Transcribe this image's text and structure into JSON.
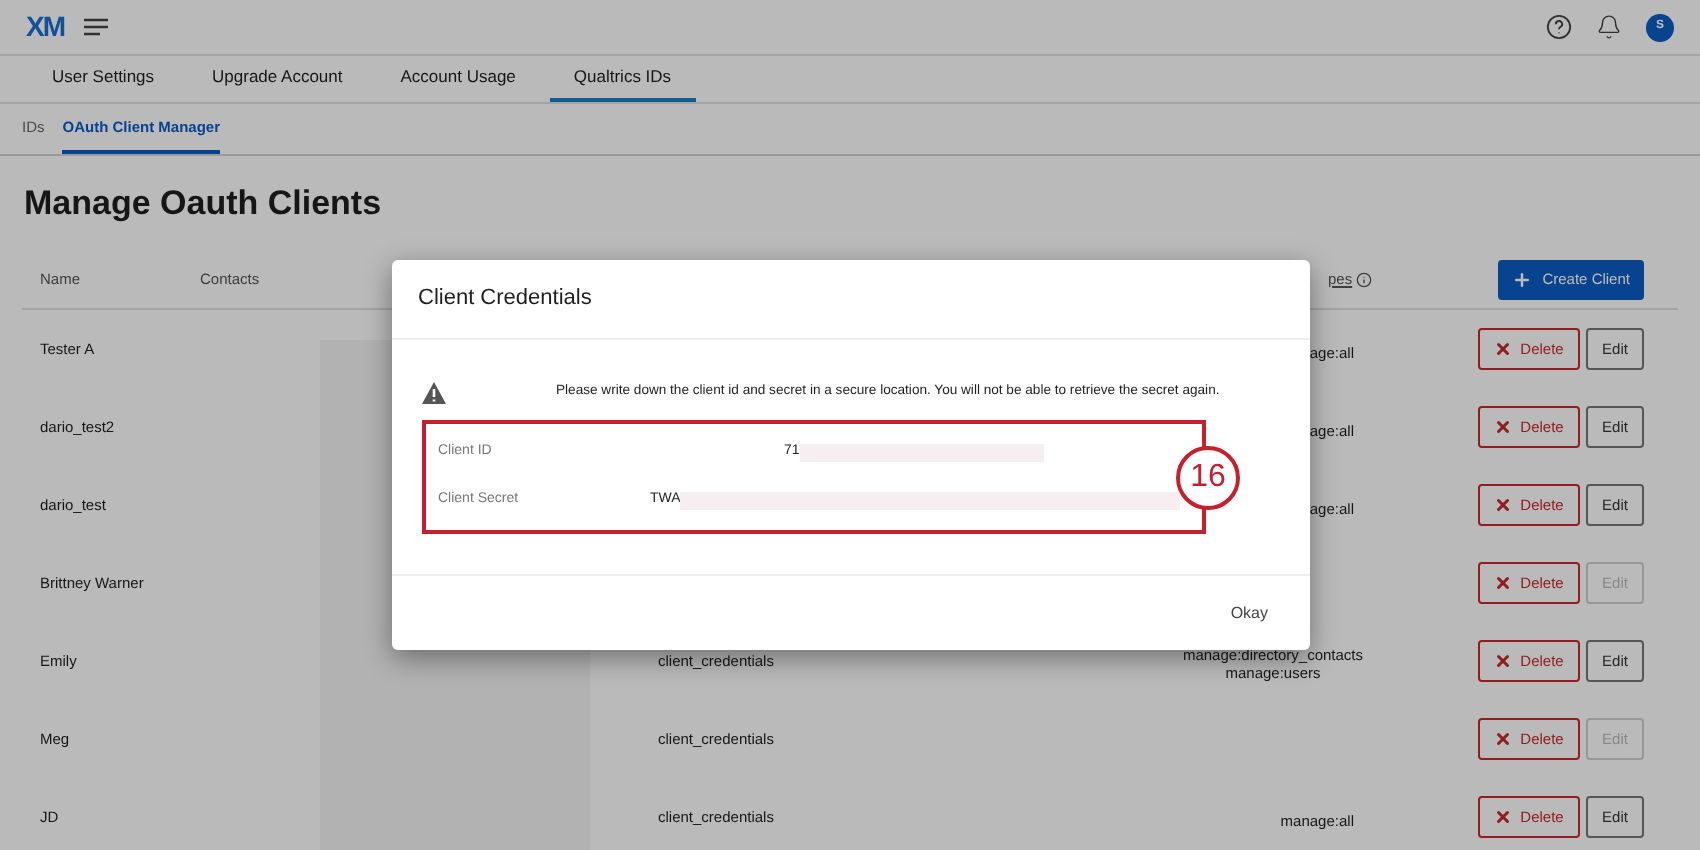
{
  "header": {
    "logo": "XM",
    "avatar": "S"
  },
  "tabs": [
    {
      "label": "User Settings",
      "selected": false
    },
    {
      "label": "Upgrade Account",
      "selected": false
    },
    {
      "label": "Account Usage",
      "selected": false
    },
    {
      "label": "Qualtrics IDs",
      "selected": true
    }
  ],
  "subtabs": [
    {
      "label": "IDs",
      "selected": false
    },
    {
      "label": "OAuth Client Manager",
      "selected": true
    }
  ],
  "page_title": "Manage Oauth Clients",
  "table": {
    "columns": [
      "Name",
      "Contacts",
      "pes"
    ],
    "create_button": "Create Client",
    "rows": [
      {
        "name": "Tester A",
        "grant_type": "",
        "scopes": [
          "age:all"
        ],
        "delete": "Delete",
        "edit": "Edit",
        "edit_disabled": false
      },
      {
        "name": "dario_test2",
        "grant_type": "",
        "scopes": [
          "age:all"
        ],
        "delete": "Delete",
        "edit": "Edit",
        "edit_disabled": false
      },
      {
        "name": "dario_test",
        "grant_type": "",
        "scopes": [
          "age:all"
        ],
        "delete": "Delete",
        "edit": "Edit",
        "edit_disabled": false
      },
      {
        "name": "Brittney Warner",
        "grant_type": "",
        "scopes": [],
        "delete": "Delete",
        "edit": "Edit",
        "edit_disabled": true
      },
      {
        "name": "Emily",
        "grant_type": "client_credentials",
        "scopes": [
          "manage:directory_contacts",
          "manage:users"
        ],
        "delete": "Delete",
        "edit": "Edit",
        "edit_disabled": false
      },
      {
        "name": "Meg",
        "grant_type": "client_credentials",
        "scopes": [],
        "delete": "Delete",
        "edit": "Edit",
        "edit_disabled": true
      },
      {
        "name": "JD",
        "grant_type": "client_credentials",
        "scopes": [
          "manage:all"
        ],
        "delete": "Delete",
        "edit": "Edit",
        "edit_disabled": false
      }
    ]
  },
  "dialog": {
    "title": "Client Credentials",
    "message": "Please write down the client id and secret in a secure location. You will not be able to retrieve the secret again.",
    "fields": [
      {
        "label": "Client ID",
        "value": "71"
      },
      {
        "label": "Client Secret",
        "value": "TWA"
      }
    ],
    "annotation": "16",
    "button": "Okay"
  }
}
